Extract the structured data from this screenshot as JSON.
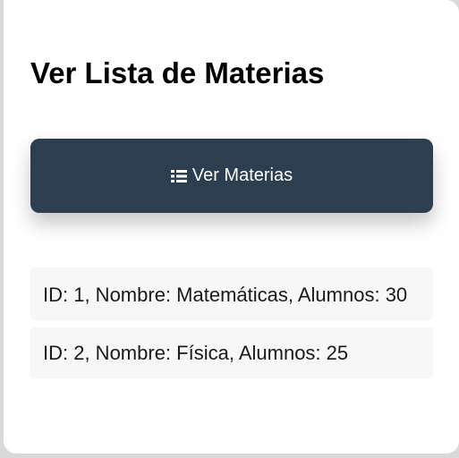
{
  "page": {
    "title": "Ver Lista de Materias"
  },
  "actions": {
    "view_button_label": "Ver Materias",
    "view_button_icon": "list-icon",
    "view_button_color": "#2c3e50"
  },
  "materias": [
    {
      "text": "ID: 1, Nombre: Matemáticas, Alumnos: 30"
    },
    {
      "text": "ID: 2, Nombre: Física, Alumnos: 25"
    }
  ]
}
